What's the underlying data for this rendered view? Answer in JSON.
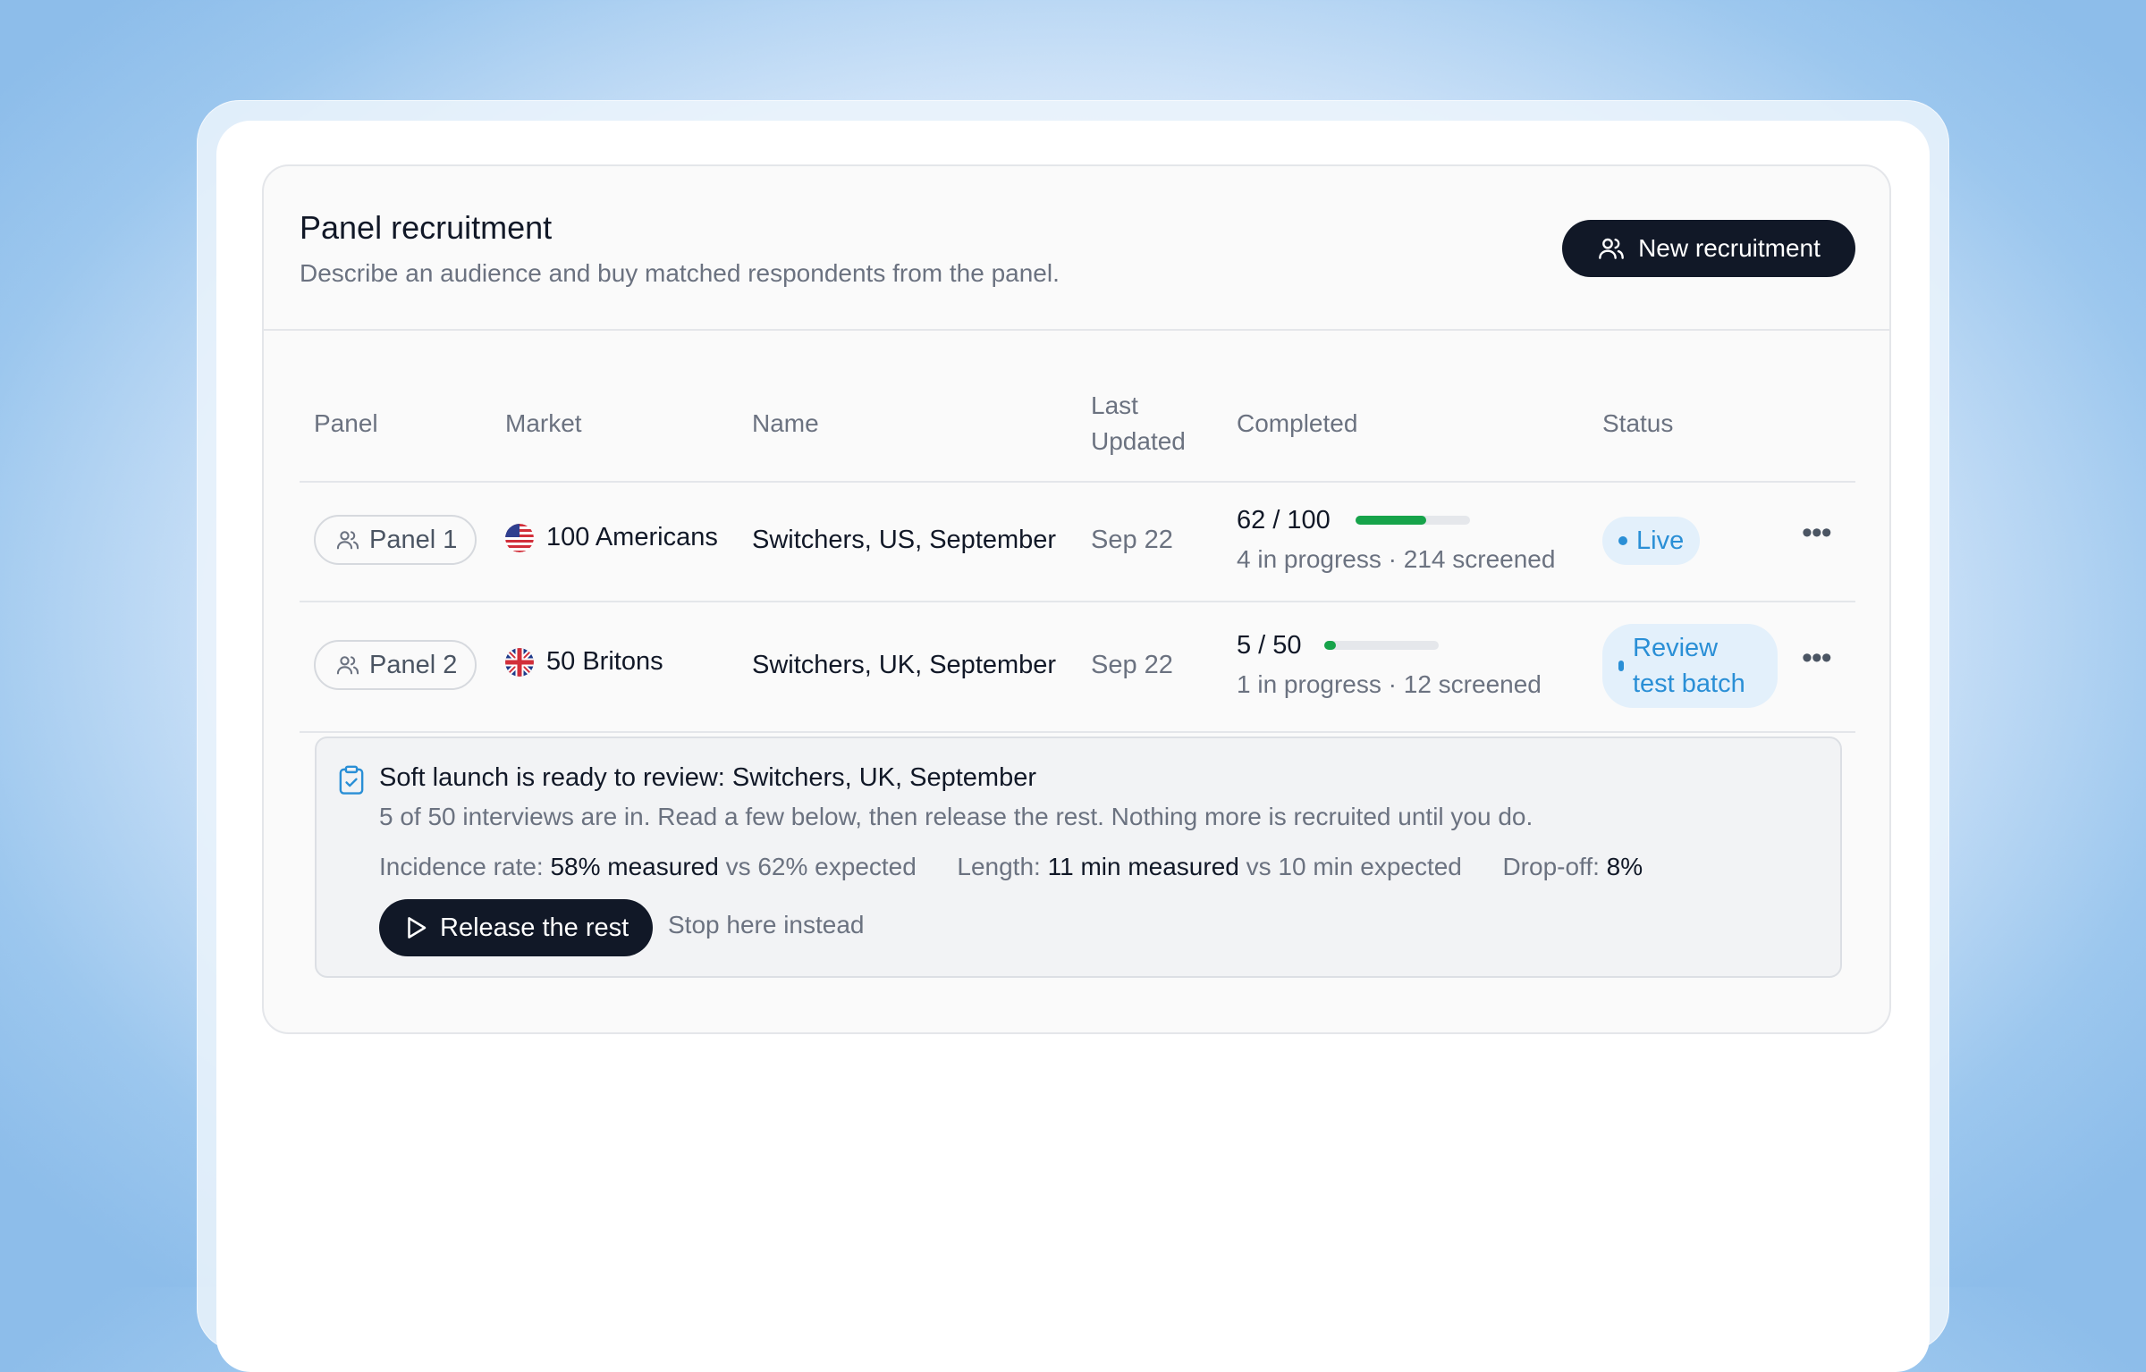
{
  "header": {
    "title": "Panel recruitment",
    "subtitle": "Describe an audience and buy matched respondents from the panel.",
    "new_button_label": "New recruitment",
    "new_button_icon": "users-icon"
  },
  "table": {
    "columns": [
      "Panel",
      "Market",
      "Name",
      "Last Updated",
      "Completed",
      "Status"
    ],
    "column_last_updated_lines": [
      "Last",
      "Updated"
    ],
    "rows": [
      {
        "panel": "Panel 1",
        "market": "100 Americans",
        "flag": "us-flag-icon",
        "name": "Switchers, US, September",
        "last_updated": "Sep 22",
        "completed": "62 / 100",
        "progress": 0.62,
        "progress_detail": "4 in progress · 214 screened",
        "status": "Live",
        "status_color": "#2a8fd6"
      },
      {
        "panel": "Panel 2",
        "market": "50 Britons",
        "flag": "uk-flag-icon",
        "name": "Switchers, UK, September",
        "last_updated": "Sep 22",
        "completed": "5 / 50",
        "progress": 0.1,
        "progress_detail": "1 in progress · 12 screened",
        "status_lines": [
          "Review",
          "test batch"
        ],
        "status_color": "#2a8fd6"
      }
    ]
  },
  "soft_launch": {
    "title": "Soft launch is ready to review: Switchers, UK, September",
    "description": "5 of 50 interviews are in. Read a few below, then release the rest. Nothing more is recruited until you do.",
    "metrics": {
      "incidence_label": "Incidence rate:",
      "incidence_measured": "58% measured",
      "incidence_expected": "vs 62% expected",
      "length_label": "Length:",
      "length_measured": "11 min measured",
      "length_expected": "vs 10 min expected",
      "dropoff_label": "Drop-off:",
      "dropoff_value": "8%"
    },
    "release_button": "Release the rest",
    "stop_link": "Stop here instead"
  },
  "colors": {
    "accent_dark": "#111827",
    "progress_green": "#16a34a",
    "status_blue": "#2a8fd6",
    "status_bg": "#e3f0fb"
  }
}
